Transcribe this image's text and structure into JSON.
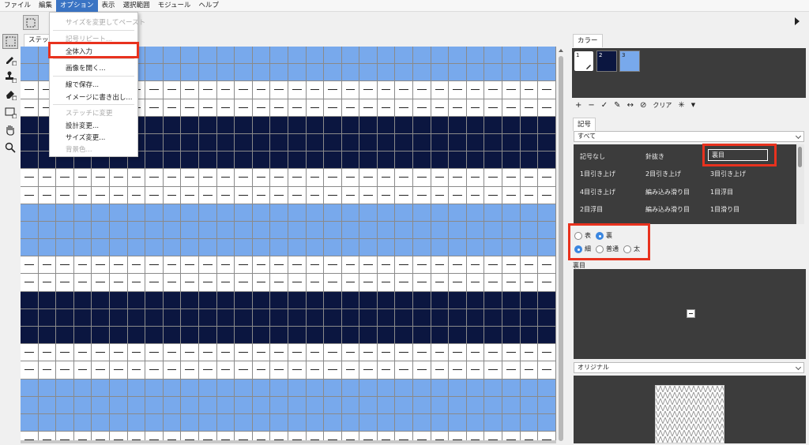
{
  "menubar": {
    "items": [
      "ファイル",
      "編集",
      "オプション",
      "表示",
      "選択範囲",
      "モジュール",
      "ヘルプ"
    ],
    "active_index": 2
  },
  "canvas_tab": {
    "label": "ステッチ"
  },
  "option_menu": {
    "items": [
      {
        "label": "サイズを変更してペースト",
        "enabled": false
      },
      {
        "label": "記号リピート...",
        "enabled": false
      },
      {
        "label": "全体入力",
        "enabled": true,
        "highlighted": true
      },
      {
        "label": "画像を開く...",
        "enabled": true
      },
      {
        "label": "線で保存...",
        "enabled": true
      },
      {
        "label": "イメージに書き出し...",
        "enabled": true
      },
      {
        "label": "ステッチに変更",
        "enabled": false
      },
      {
        "label": "設計変更...",
        "enabled": true
      },
      {
        "label": "サイズ変更...",
        "enabled": true
      },
      {
        "label": "背景色...",
        "enabled": false
      }
    ]
  },
  "color_panel": {
    "title": "カラー",
    "swatches": [
      {
        "number": "1",
        "color": "#ffffff",
        "selected": true
      },
      {
        "number": "2",
        "color": "#0b1640"
      },
      {
        "number": "3",
        "color": "#78a9ec"
      }
    ],
    "tools": {
      "clear_label": "クリア"
    }
  },
  "symbol_panel": {
    "title": "記号",
    "filter": "すべて",
    "symbols": [
      [
        "記号なし",
        "針抜き",
        "裏目"
      ],
      [
        "1目引き上げ",
        "2目引き上げ",
        "3目引き上げ"
      ],
      [
        "4目引き上げ",
        "編み込み滑り目",
        "1目浮目"
      ],
      [
        "2目浮目",
        "編み込み滑り目",
        "1目滑り目"
      ]
    ],
    "selected": "裏目",
    "side": {
      "front": "表",
      "back": "裏",
      "selected": "裏"
    },
    "weight": {
      "thin": "細",
      "normal": "普通",
      "thick": "太",
      "selected": "細"
    },
    "preview_label": "裏目",
    "view_select": "オリジナル"
  },
  "grid": {
    "colors": {
      "light": "#78a9ec",
      "dark": "#0b1640",
      "white": "#ffffff",
      "line": "#8a8a8a"
    },
    "columns": 30,
    "rows": [
      "L",
      "L",
      "W",
      "W",
      "D",
      "D",
      "D",
      "W",
      "W",
      "L",
      "L",
      "L",
      "W",
      "W",
      "D",
      "D",
      "D",
      "W",
      "W",
      "L",
      "L",
      "L",
      "W"
    ]
  }
}
